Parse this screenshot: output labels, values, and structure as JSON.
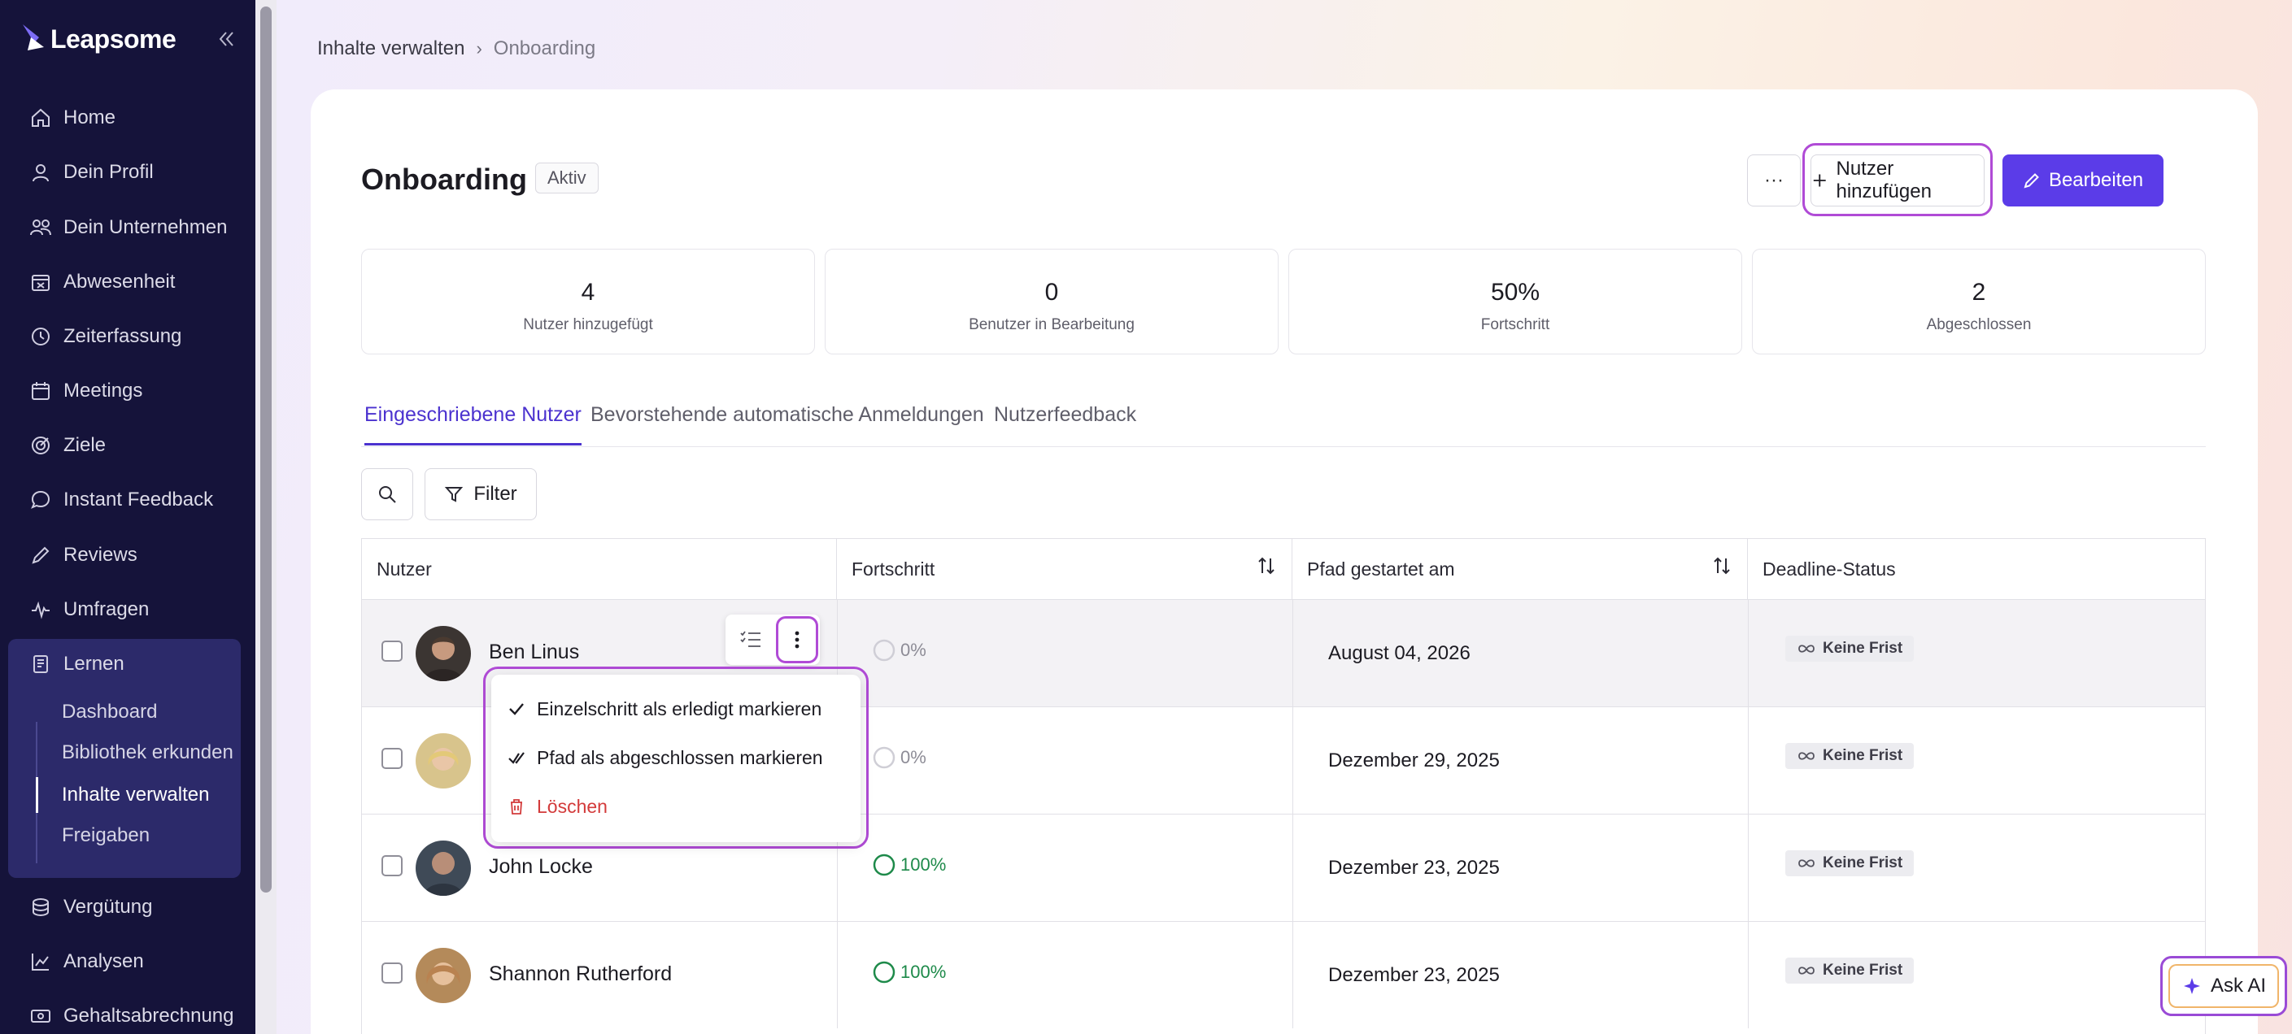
{
  "app": {
    "name": "Leapsome"
  },
  "sidebar": {
    "items": [
      {
        "label": "Home",
        "icon": "home-icon"
      },
      {
        "label": "Dein Profil",
        "icon": "user-icon"
      },
      {
        "label": "Dein Unternehmen",
        "icon": "users-icon"
      },
      {
        "label": "Abwesenheit",
        "icon": "calendar-x-icon"
      },
      {
        "label": "Zeiterfassung",
        "icon": "clock-icon"
      },
      {
        "label": "Meetings",
        "icon": "calendar-icon"
      },
      {
        "label": "Ziele",
        "icon": "target-icon"
      },
      {
        "label": "Instant Feedback",
        "icon": "chat-icon"
      },
      {
        "label": "Reviews",
        "icon": "pencil-icon"
      },
      {
        "label": "Umfragen",
        "icon": "pulse-icon"
      },
      {
        "label": "Lernen",
        "icon": "book-icon"
      },
      {
        "label": "Vergütung",
        "icon": "coins-icon"
      },
      {
        "label": "Analysen",
        "icon": "chart-icon"
      },
      {
        "label": "Gehaltsabrechnung",
        "icon": "money-icon"
      }
    ],
    "learn_sub": [
      "Dashboard",
      "Bibliothek erkunden",
      "Inhalte verwalten",
      "Freigaben"
    ]
  },
  "breadcrumb": {
    "parent": "Inhalte verwalten",
    "current": "Onboarding"
  },
  "page": {
    "title": "Onboarding",
    "status": "Aktiv",
    "more_label": "···",
    "add_user_label": "Nutzer hinzufügen",
    "edit_label": "Bearbeiten"
  },
  "stats": [
    {
      "value": "4",
      "label": "Nutzer hinzugefügt"
    },
    {
      "value": "0",
      "label": "Benutzer in Bearbeitung"
    },
    {
      "value": "50%",
      "label": "Fortschritt"
    },
    {
      "value": "2",
      "label": "Abgeschlossen"
    }
  ],
  "tabs": [
    "Eingeschriebene Nutzer",
    "Bevorstehende automatische Anmeldungen",
    "Nutzerfeedback"
  ],
  "filter_label": "Filter",
  "table": {
    "headers": [
      "Nutzer",
      "Fortschritt",
      "Pfad gestartet am",
      "Deadline-Status"
    ],
    "rows": [
      {
        "name": "Ben Linus",
        "progress": "0%",
        "started": "August 04, 2026",
        "deadline": "Keine Frist"
      },
      {
        "name": "",
        "progress": "0%",
        "started": "Dezember 29, 2025",
        "deadline": "Keine Frist"
      },
      {
        "name": "John Locke",
        "progress": "100%",
        "started": "Dezember 23, 2025",
        "deadline": "Keine Frist"
      },
      {
        "name": "Shannon Rutherford",
        "progress": "100%",
        "started": "Dezember 23, 2025",
        "deadline": "Keine Frist"
      }
    ]
  },
  "context_menu": {
    "items": [
      "Einzelschritt als erledigt markieren",
      "Pfad als abgeschlossen markieren",
      "Löschen"
    ]
  },
  "ask_ai_label": "Ask AI",
  "colors": {
    "sidebar_bg": "#15133a",
    "accent": "#5b3ce8",
    "highlight": "#b04bd6",
    "success": "#1e8a4a",
    "danger": "#d33b3b"
  }
}
